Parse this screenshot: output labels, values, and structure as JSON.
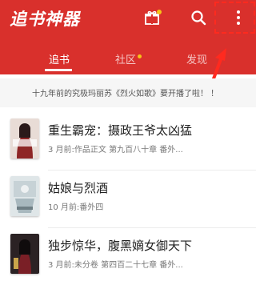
{
  "app": {
    "title": "追书神器"
  },
  "header": {
    "icons": {
      "gift": "gift-icon",
      "search": "search-icon",
      "menu": "more-vertical-icon"
    }
  },
  "tabs": [
    {
      "label": "追书",
      "active": true
    },
    {
      "label": "社区",
      "active": false,
      "badge": true
    },
    {
      "label": "发现",
      "active": false
    }
  ],
  "notice": {
    "text": "十九年前的究极玛丽苏《烈火如歌》要开播了啦！ ！"
  },
  "books": [
    {
      "title": "重生霸宠：摄政王爷太凶猛",
      "meta": "3 月前:作品正文 第九百八十章 番外..."
    },
    {
      "title": "姑娘与烈酒",
      "meta": "10 月前:番外四"
    },
    {
      "title": "独步惊华，腹黑嫡女御天下",
      "meta": "3 月前:未分卷 第四百二十七章 番外..."
    }
  ],
  "colors": {
    "brand": "#d9302c",
    "badge": "#f5c518",
    "annotation": "#ff2a1f"
  }
}
